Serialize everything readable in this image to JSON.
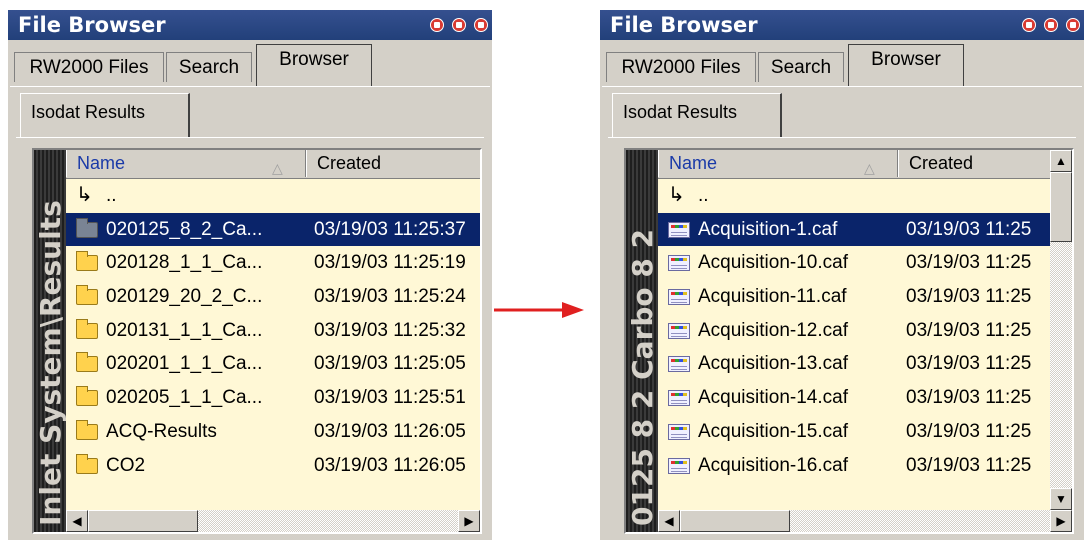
{
  "colors": {
    "titlebar": "#22407a",
    "panel": "#d4d0c8",
    "list_bg": "#fff8d6",
    "selection": "#0a246a",
    "arrow": "#e02020"
  },
  "left": {
    "title": "File Browser",
    "tabs": [
      "RW2000 Files",
      "Search",
      "Browser"
    ],
    "subtab": "Isodat Results",
    "vertical_label": "Inlet System\\Results",
    "columns": {
      "name": "Name",
      "created": "Created"
    },
    "rows": [
      {
        "name": "..",
        "created": "",
        "icon": "up-arrow-icon"
      },
      {
        "name": "020125_8_2_Ca...",
        "created": "03/19/03 11:25:37",
        "icon": "folder-icon",
        "selected": true
      },
      {
        "name": "020128_1_1_Ca...",
        "created": "03/19/03 11:25:19",
        "icon": "folder-icon"
      },
      {
        "name": "020129_20_2_C...",
        "created": "03/19/03 11:25:24",
        "icon": "folder-icon"
      },
      {
        "name": "020131_1_1_Ca...",
        "created": "03/19/03 11:25:32",
        "icon": "folder-icon"
      },
      {
        "name": "020201_1_1_Ca...",
        "created": "03/19/03 11:25:05",
        "icon": "folder-icon"
      },
      {
        "name": "020205_1_1_Ca...",
        "created": "03/19/03 11:25:51",
        "icon": "folder-icon"
      },
      {
        "name": "ACQ-Results",
        "created": "03/19/03 11:26:05",
        "icon": "folder-icon"
      },
      {
        "name": "CO2",
        "created": "03/19/03 11:26:05",
        "icon": "folder-icon"
      }
    ]
  },
  "right": {
    "title": "File Browser",
    "tabs": [
      "RW2000 Files",
      "Search",
      "Browser"
    ],
    "subtab": "Isodat Results",
    "vertical_label": "0125 8 2 Carbo 8 2",
    "columns": {
      "name": "Name",
      "created": "Created"
    },
    "rows": [
      {
        "name": "..",
        "created": "",
        "icon": "up-arrow-icon"
      },
      {
        "name": "Acquisition-1.caf",
        "created": "03/19/03 11:25",
        "icon": "caf-file-icon",
        "selected": true
      },
      {
        "name": "Acquisition-10.caf",
        "created": "03/19/03 11:25",
        "icon": "caf-file-icon"
      },
      {
        "name": "Acquisition-11.caf",
        "created": "03/19/03 11:25",
        "icon": "caf-file-icon"
      },
      {
        "name": "Acquisition-12.caf",
        "created": "03/19/03 11:25",
        "icon": "caf-file-icon"
      },
      {
        "name": "Acquisition-13.caf",
        "created": "03/19/03 11:25",
        "icon": "caf-file-icon"
      },
      {
        "name": "Acquisition-14.caf",
        "created": "03/19/03 11:25",
        "icon": "caf-file-icon"
      },
      {
        "name": "Acquisition-15.caf",
        "created": "03/19/03 11:25",
        "icon": "caf-file-icon"
      },
      {
        "name": "Acquisition-16.caf",
        "created": "03/19/03 11:25",
        "icon": "caf-file-icon"
      }
    ]
  }
}
